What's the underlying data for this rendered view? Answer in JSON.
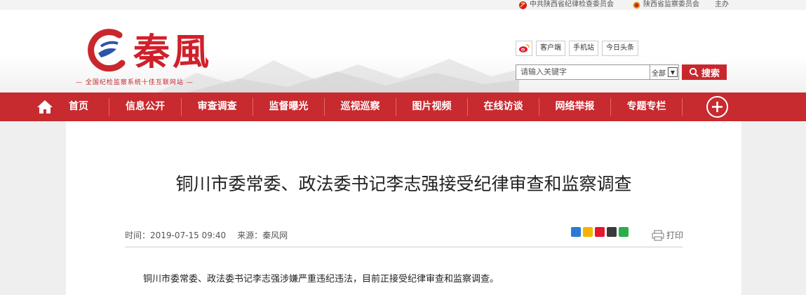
{
  "topbar": {
    "link1": "中共陕西省纪律检查委员会",
    "link2": "陕西省监察委员会",
    "link3": "主办"
  },
  "header": {
    "logo_text": "秦風",
    "slogan": "— 全国纪检监察系统十佳互联网站 —",
    "social": {
      "client": "客户端",
      "mobile": "手机站",
      "toutiao": "今日头条"
    },
    "search": {
      "placeholder": "请输入关键字",
      "scope": "全部",
      "button": "搜索"
    }
  },
  "nav": {
    "items": [
      "首页",
      "信息公开",
      "审查调查",
      "监督曝光",
      "巡视巡察",
      "图片视频",
      "在线访谈",
      "网络举报",
      "专题专栏"
    ]
  },
  "article": {
    "title": "铜川市委常委、政法委书记李志强接受纪律审查和监察调查",
    "time_label": "时间：2019-07-15 09:40",
    "source_label": "来源：秦风网",
    "print_label": "打印",
    "body": "铜川市委常委、政法委书记李志强涉嫌严重违纪违法，目前正接受纪律审查和监察调查。"
  },
  "colors": {
    "brand_red": "#c72a2f",
    "page_bg": "#efefef"
  },
  "icons": {
    "home": "home-icon",
    "weibo": "weibo-icon",
    "search": "search-icon",
    "add": "plus-circle-icon",
    "print": "printer-icon"
  }
}
